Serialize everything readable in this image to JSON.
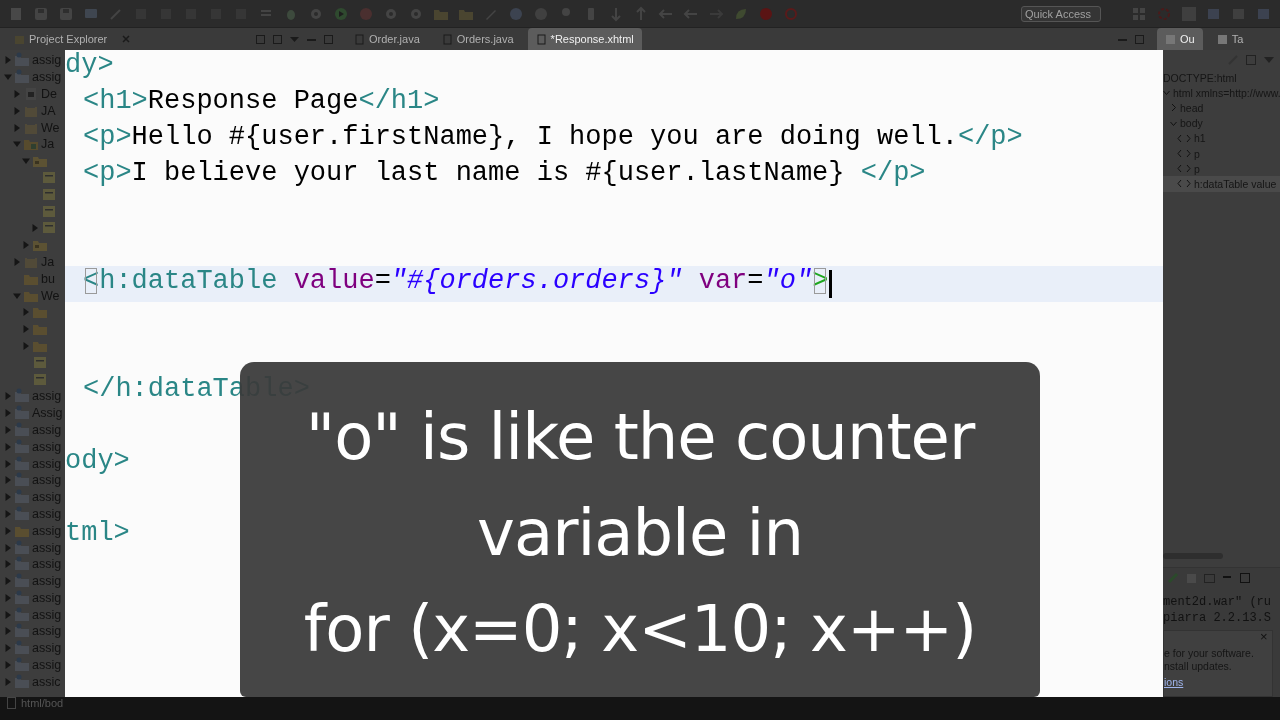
{
  "toolbar": {
    "quick_access": {
      "placeholder": "Quick Access"
    }
  },
  "tabs": {
    "left": [
      {
        "label": "Project Explorer",
        "selected": false
      }
    ],
    "editor": [
      {
        "label": "Order.java",
        "selected": false
      },
      {
        "label": "Orders.java",
        "selected": false
      },
      {
        "label": "*Response.xhtml",
        "selected": true
      }
    ],
    "right": [
      {
        "label": "Ou",
        "selected": true
      },
      {
        "label": "Ta",
        "selected": false
      }
    ]
  },
  "project_tree": [
    {
      "label": "assig",
      "kind": "project",
      "expanded": false
    },
    {
      "label": "assig",
      "kind": "project",
      "expanded": true,
      "children": [
        {
          "label": "De",
          "kind": "descriptor",
          "expanded": false
        },
        {
          "label": "JA",
          "kind": "library",
          "expanded": false
        },
        {
          "label": "We",
          "kind": "library",
          "expanded": false
        },
        {
          "label": "Ja",
          "kind": "source",
          "expanded": true,
          "children": [
            {
              "kind": "package",
              "expanded": true,
              "children": [
                {
                  "kind": "file"
                },
                {
                  "kind": "file"
                },
                {
                  "kind": "file"
                },
                {
                  "kind": "file",
                  "expanded": false
                }
              ]
            },
            {
              "kind": "package",
              "expanded": false
            }
          ]
        },
        {
          "label": "Ja",
          "kind": "library",
          "expanded": false
        },
        {
          "label": "bu",
          "kind": "folder"
        },
        {
          "label": "We",
          "kind": "folder",
          "expanded": true,
          "children": [
            {
              "kind": "folder",
              "expanded": false
            },
            {
              "kind": "folder",
              "expanded": false
            },
            {
              "kind": "folder",
              "expanded": false
            },
            {
              "kind": "file"
            },
            {
              "kind": "file"
            }
          ]
        }
      ]
    },
    {
      "label": "assig",
      "kind": "project",
      "expanded": false
    },
    {
      "label": "Assig",
      "kind": "project",
      "expanded": false
    },
    {
      "label": "assig",
      "kind": "project",
      "expanded": false
    },
    {
      "label": "assig",
      "kind": "project",
      "expanded": false
    },
    {
      "label": "assig",
      "kind": "project",
      "expanded": false
    },
    {
      "label": "assig",
      "kind": "project",
      "expanded": false
    },
    {
      "label": "assig",
      "kind": "project",
      "expanded": false
    },
    {
      "label": "assig",
      "kind": "project",
      "expanded": false
    },
    {
      "label": "assig",
      "kind": "folder",
      "expanded": false
    },
    {
      "label": "assig",
      "kind": "project",
      "expanded": false
    },
    {
      "label": "assig",
      "kind": "project",
      "expanded": false
    },
    {
      "label": "assig",
      "kind": "project",
      "expanded": false
    },
    {
      "label": "assig",
      "kind": "project",
      "expanded": false
    },
    {
      "label": "assig",
      "kind": "project",
      "expanded": false
    },
    {
      "label": "assig",
      "kind": "project",
      "expanded": false
    },
    {
      "label": "assig",
      "kind": "project",
      "expanded": false
    },
    {
      "label": "assig",
      "kind": "project",
      "expanded": false
    },
    {
      "label": "assic",
      "kind": "project",
      "expanded": false
    }
  ],
  "outline": [
    {
      "label": "DOCTYPE:html",
      "selected": false
    },
    {
      "label": "html xmlns=http://www.",
      "selected": false,
      "expanded": true,
      "children": [
        {
          "label": "head",
          "selected": false,
          "expanded": false
        },
        {
          "label": "body",
          "selected": false,
          "expanded": true,
          "children": [
            {
              "label": "h1",
              "selected": false
            },
            {
              "label": "p",
              "selected": false
            },
            {
              "label": "p",
              "selected": false
            },
            {
              "label": "h:dataTable value",
              "selected": true
            }
          ]
        }
      ]
    }
  ],
  "console": {
    "lines": [
      "ment2d.war\" (ru",
      "piarra 2.2.13.S"
    ],
    "notification": {
      "close": "×",
      "lines": [
        "e for your software.",
        "nstall updates."
      ],
      "link": "ions"
    }
  },
  "status_bar": {
    "path": "html/bod"
  },
  "editor_zoom": {
    "lines": [
      {
        "kind": "code",
        "indented": false,
        "current": false,
        "tokens": [
          {
            "kind": "tag",
            "text": "dy>"
          }
        ]
      },
      {
        "kind": "code",
        "indented": true,
        "current": false,
        "tokens": [
          {
            "kind": "tag",
            "text": "<h1>"
          },
          {
            "kind": "text",
            "text": "Response Page"
          },
          {
            "kind": "tag",
            "text": "</h1>"
          }
        ]
      },
      {
        "kind": "code",
        "indented": true,
        "current": false,
        "tokens": [
          {
            "kind": "tag",
            "text": "<p>"
          },
          {
            "kind": "text",
            "text": "Hello #{user.firstName}, I hope you are doing well."
          },
          {
            "kind": "tag",
            "text": "</p>"
          }
        ]
      },
      {
        "kind": "code",
        "indented": true,
        "current": false,
        "tokens": [
          {
            "kind": "tag",
            "text": "<p>"
          },
          {
            "kind": "text",
            "text": "I believe your last name is #{user.lastName} "
          },
          {
            "kind": "tag",
            "text": "</p>"
          }
        ]
      },
      {
        "kind": "blank"
      },
      {
        "kind": "blank"
      },
      {
        "kind": "code",
        "indented": true,
        "current": true,
        "tokens": [
          {
            "kind": "match_open",
            "text": "<"
          },
          {
            "kind": "tag",
            "text": "h:dataTable "
          },
          {
            "kind": "attr",
            "text": "value"
          },
          {
            "kind": "text",
            "text": "="
          },
          {
            "kind": "value",
            "text": "\"#{orders.orders}\""
          },
          {
            "kind": "attr",
            "text": " var"
          },
          {
            "kind": "text",
            "text": "="
          },
          {
            "kind": "value",
            "text": "\"o\""
          },
          {
            "kind": "match_close",
            "text": ">"
          }
        ]
      },
      {
        "kind": "blank"
      },
      {
        "kind": "blank"
      },
      {
        "kind": "code",
        "indented": true,
        "current": false,
        "tokens": [
          {
            "kind": "tag",
            "text": "</h:dataTable>"
          }
        ]
      },
      {
        "kind": "blank"
      },
      {
        "kind": "code",
        "indented": false,
        "current": false,
        "tokens": [
          {
            "kind": "tag",
            "text": "ody>"
          }
        ]
      },
      {
        "kind": "blank"
      },
      {
        "kind": "code",
        "indented": false,
        "current": false,
        "tokens": [
          {
            "kind": "tag",
            "text": "tml>"
          }
        ]
      }
    ]
  },
  "caption": {
    "lines": [
      "\"o\" is like the counter",
      "variable in",
      "for (x=0; x<10; x++)"
    ]
  }
}
